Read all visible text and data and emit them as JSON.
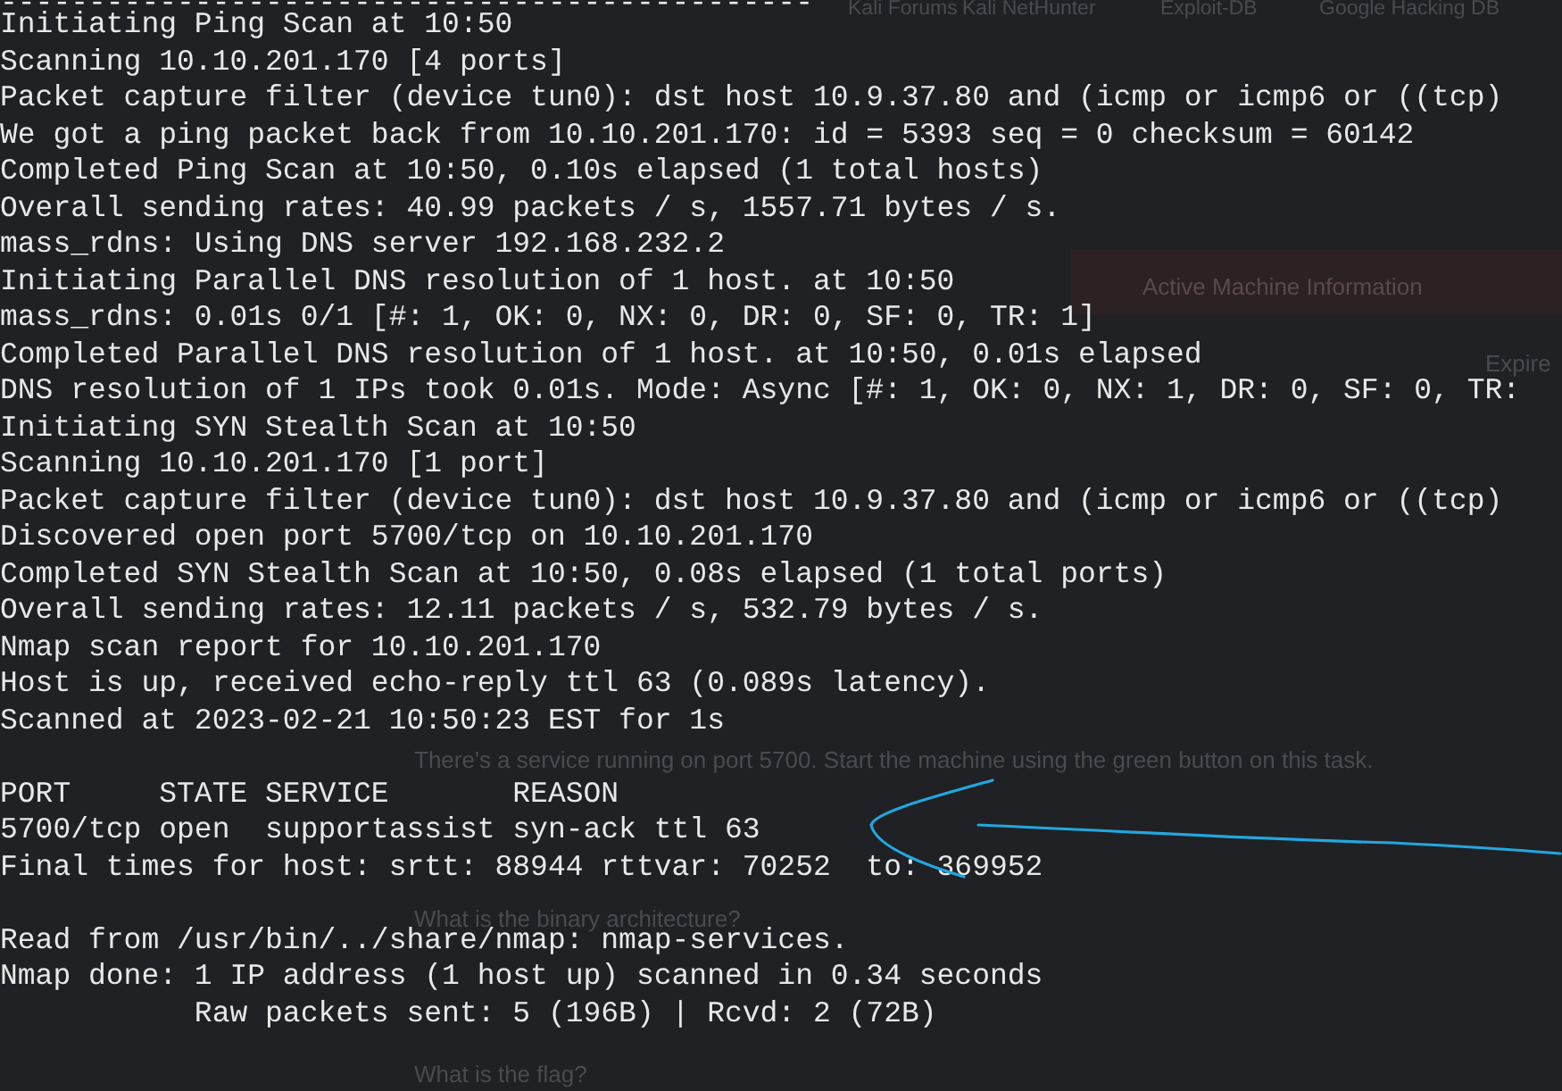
{
  "browser_behind": {
    "bookmarks": [
      "Kali Forums",
      "Kali NetHunter",
      "Exploit-DB",
      "Google Hacking DB"
    ],
    "machine_banner": "Active Machine Information",
    "column_heading": "Expire",
    "task_text": "There's a service running on port 5700. Start the machine using the green button on this task.",
    "questions": [
      "What is the binary architecture?",
      "What is the flag?"
    ]
  },
  "terminal": {
    "divider": "----------------------------------------------",
    "blocks": [
      {
        "lines": [
          "Initiating Ping Scan at 10:50",
          "Scanning 10.10.201.170 [4 ports]",
          "Packet capture filter (device tun0): dst host 10.9.37.80 and (icmp or icmp6 or ((tcp)",
          "We got a ping packet back from 10.10.201.170: id = 5393 seq = 0 checksum = 60142",
          "Completed Ping Scan at 10:50, 0.10s elapsed (1 total hosts)",
          "Overall sending rates: 40.99 packets / s, 1557.71 bytes / s.",
          "mass_rdns: Using DNS server 192.168.232.2",
          "Initiating Parallel DNS resolution of 1 host. at 10:50",
          "mass_rdns: 0.01s 0/1 [#: 1, OK: 0, NX: 0, DR: 0, SF: 0, TR: 1]",
          "Completed Parallel DNS resolution of 1 host. at 10:50, 0.01s elapsed",
          "DNS resolution of 1 IPs took 0.01s. Mode: Async [#: 1, OK: 0, NX: 1, DR: 0, SF: 0, TR:",
          "Initiating SYN Stealth Scan at 10:50",
          "Scanning 10.10.201.170 [1 port]",
          "Packet capture filter (device tun0): dst host 10.9.37.80 and (icmp or icmp6 or ((tcp)",
          "Discovered open port 5700/tcp on 10.10.201.170",
          "Completed SYN Stealth Scan at 10:50, 0.08s elapsed (1 total ports)",
          "Overall sending rates: 12.11 packets / s, 532.79 bytes / s.",
          "Nmap scan report for 10.10.201.170",
          "Host is up, received echo-reply ttl 63 (0.089s latency).",
          "Scanned at 2023-02-21 10:50:23 EST for 1s"
        ]
      },
      {
        "lines": [
          "PORT     STATE SERVICE       REASON",
          "5700/tcp open  supportassist syn-ack ttl 63",
          "Final times for host: srtt: 88944 rttvar: 70252  to: 369952"
        ]
      },
      {
        "lines": [
          "Read from /usr/bin/../share/nmap: nmap-services.",
          "Nmap done: 1 IP address (1 host up) scanned in 0.34 seconds",
          "           Raw packets sent: 5 (196B) | Rcvd: 2 (72B)"
        ]
      }
    ]
  }
}
